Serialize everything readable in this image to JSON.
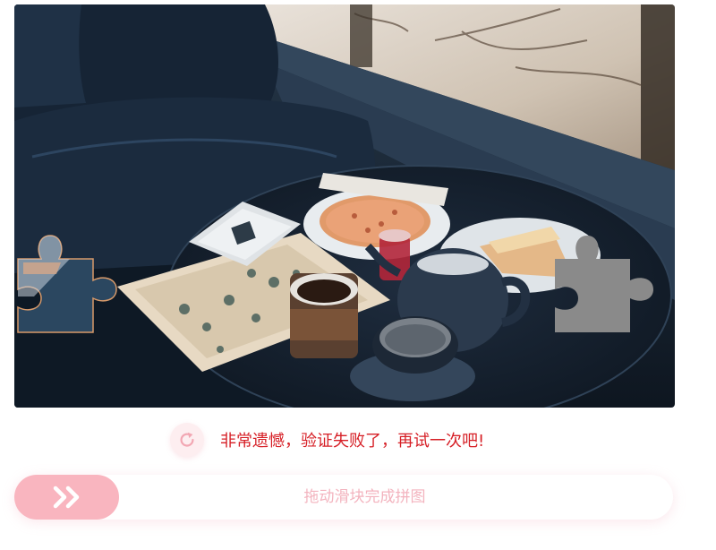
{
  "captcha": {
    "background": {
      "subject": "cafe table with coffee cups, teapot, plates and map by window",
      "icon": "photo-background"
    },
    "source_piece": {
      "icon": "puzzle-piece-icon"
    },
    "target_hole": {
      "icon": "puzzle-hole-icon"
    },
    "status": {
      "message": "非常遗憾，验证失败了，再试一次吧!",
      "color": "#d61f26"
    },
    "refresh": {
      "icon": "refresh-icon"
    },
    "slider": {
      "hint": "拖动滑块完成拼图",
      "handle_icon": "double-chevron-right-icon",
      "accent": "#f9b5bf",
      "progress": 0
    }
  }
}
